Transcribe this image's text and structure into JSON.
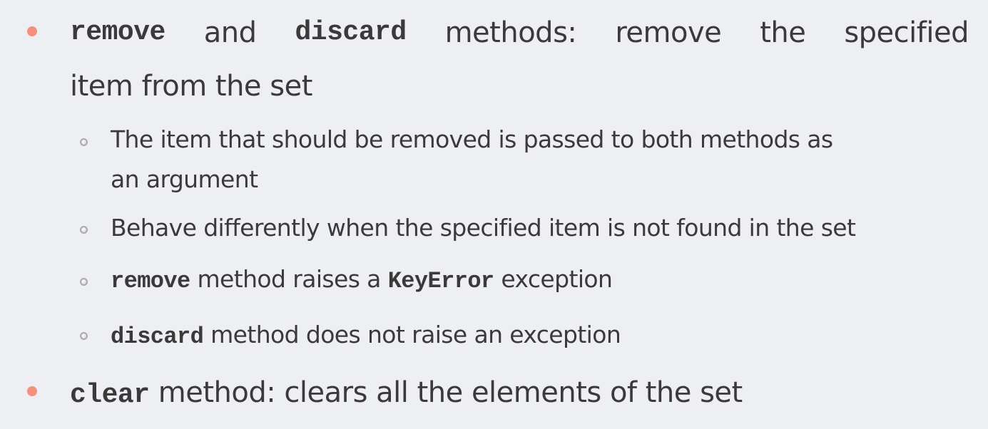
{
  "bullets": [
    {
      "parts": [
        {
          "code": "remove"
        },
        {
          "text": " and "
        },
        {
          "code": "discard"
        },
        {
          "text": " methods: remove the specified"
        }
      ],
      "continuation": "item from the set",
      "sub": [
        {
          "line1": "The item that should be removed is passed to both methods as",
          "line2": "an argument"
        },
        {
          "line1": "Behave differently when the specified item is not found in the set"
        },
        {
          "code1": "remove",
          "text1": " method raises a ",
          "code2": "KeyError",
          "text2": " exception"
        },
        {
          "code1": "discard",
          "text1": " method does not raise an exception"
        }
      ]
    },
    {
      "code": "clear",
      "text": " method: clears all the elements of the set"
    }
  ]
}
